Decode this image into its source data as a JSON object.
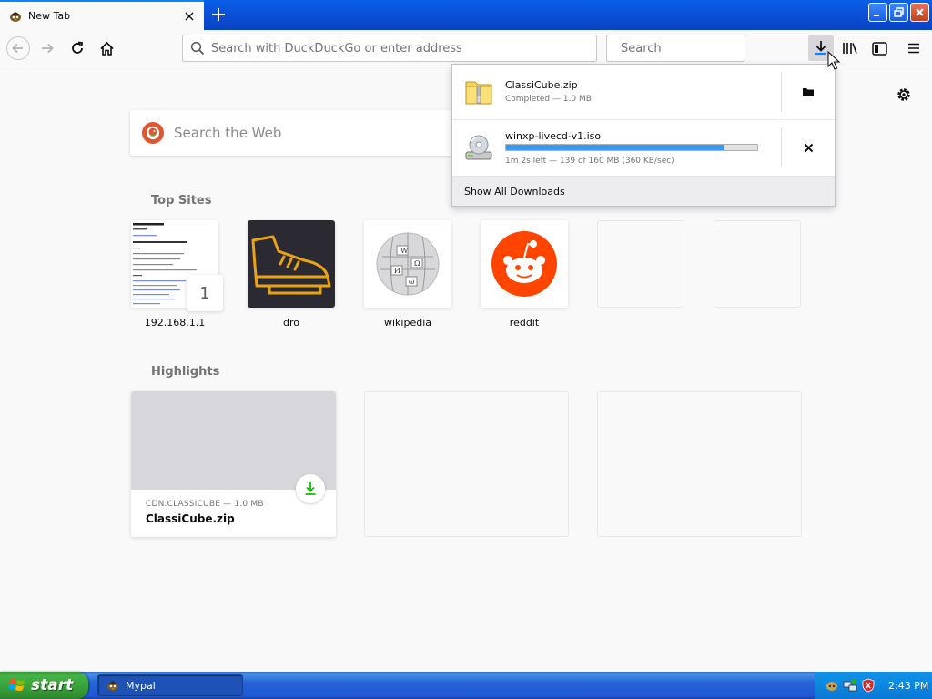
{
  "tab": {
    "title": "New Tab"
  },
  "navbar": {
    "url_placeholder": "Search with DuckDuckGo or enter address",
    "search_placeholder": "Search"
  },
  "newtab": {
    "search_placeholder": "Search the Web",
    "top_sites_title": "Top Sites",
    "top_sites": [
      {
        "label": "192.168.1.1",
        "badge": "1"
      },
      {
        "label": "dro"
      },
      {
        "label": "wikipedia"
      },
      {
        "label": "reddit"
      },
      {
        "label": ""
      },
      {
        "label": ""
      }
    ],
    "highlights_title": "Highlights",
    "highlights": [
      {
        "meta": "CDN.CLASSICUBE — 1.0 MB",
        "title": "ClassiCube.zip"
      }
    ]
  },
  "downloads": {
    "items": [
      {
        "name": "ClassiCube.zip",
        "status": "Completed — 1.0 MB",
        "icon": "zip-file-icon",
        "action": "open-folder-icon"
      },
      {
        "name": "winxp-livecd-v1.iso",
        "status": "1m 2s left — 139 of 160 MB (360 KB/sec)",
        "progress": 0.87,
        "icon": "disc-image-icon",
        "action": "cancel-icon"
      }
    ],
    "footer": "Show All Downloads"
  },
  "taskbar": {
    "start_label": "start",
    "task_label": "Mypal",
    "clock": "2:43 PM"
  },
  "colors": {
    "accent": "#0a84ff",
    "progress": "#3c9af7",
    "reddit": "#ff4500",
    "ddg": "#de5833",
    "dro_bg": "#2b2a33",
    "dro_stroke": "#e8a317",
    "download_green": "#12bc00"
  }
}
